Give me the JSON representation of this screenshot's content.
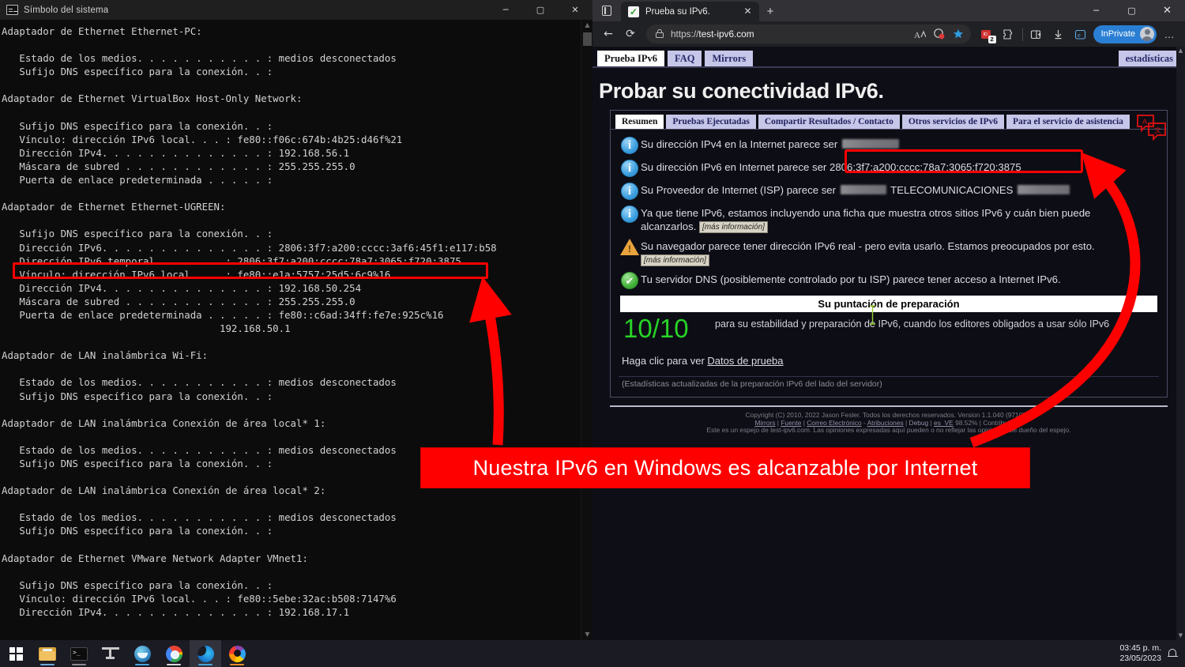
{
  "cmd": {
    "title": "Símbolo del sistema",
    "controls": {
      "minimize": "─",
      "maximize": "▢",
      "close": "✕"
    },
    "output": "Adaptador de Ethernet Ethernet-PC:\n\n   Estado de los medios. . . . . . . . . . . : medios desconectados\n   Sufijo DNS específico para la conexión. . :\n\nAdaptador de Ethernet VirtualBox Host-Only Network:\n\n   Sufijo DNS específico para la conexión. . :\n   Vínculo: dirección IPv6 local. . . : fe80::f06c:674b:4b25:d46f%21\n   Dirección IPv4. . . . . . . . . . . . . . : 192.168.56.1\n   Máscara de subred . . . . . . . . . . . . : 255.255.255.0\n   Puerta de enlace predeterminada . . . . . :\n\nAdaptador de Ethernet Ethernet-UGREEN:\n\n   Sufijo DNS específico para la conexión. . :\n   Dirección IPv6. . . . . . . . . . . . . . : 2806:3f7:a200:cccc:3af6:45f1:e117:b58\n   Dirección IPv6 temporal. . . . . . : 2806:3f7:a200:cccc:78a7:3065:f720:3875\n   Vínculo: dirección IPv6 local. . . : fe80::e1a:5757:25d5:6c9%16\n   Dirección IPv4. . . . . . . . . . . . . . : 192.168.50.254\n   Máscara de subred . . . . . . . . . . . . : 255.255.255.0\n   Puerta de enlace predeterminada . . . . . : fe80::c6ad:34ff:fe7e:925c%16\n                                     192.168.50.1\n\nAdaptador de LAN inalámbrica Wi-Fi:\n\n   Estado de los medios. . . . . . . . . . . : medios desconectados\n   Sufijo DNS específico para la conexión. . :\n\nAdaptador de LAN inalámbrica Conexión de área local* 1:\n\n   Estado de los medios. . . . . . . . . . . : medios desconectados\n   Sufijo DNS específico para la conexión. . :\n\nAdaptador de LAN inalámbrica Conexión de área local* 2:\n\n   Estado de los medios. . . . . . . . . . . : medios desconectados\n   Sufijo DNS específico para la conexión. . :\n\nAdaptador de Ethernet VMware Network Adapter VMnet1:\n\n   Sufijo DNS específico para la conexión. . :\n   Vínculo: dirección IPv6 local. . . : fe80::5ebe:32ac:b508:7147%6\n   Dirección IPv4. . . . . . . . . . . . . . : 192.168.17.1"
  },
  "browser": {
    "tab": {
      "title": "Prueba su IPv6.",
      "close_label": "✕"
    },
    "new_tab_label": "+",
    "window_controls": {
      "minimize": "─",
      "maximize": "▢",
      "close": "✕"
    },
    "nav": {
      "back": "←",
      "reload": "⟳"
    },
    "address": {
      "protocol": "https://",
      "host": "test-ipv6.com"
    },
    "inprivate_label": "InPrivate",
    "collections_badge": "2",
    "more_label": "…"
  },
  "site": {
    "tabs": [
      {
        "label": "Prueba IPv6",
        "active": true
      },
      {
        "label": "FAQ",
        "active": false
      },
      {
        "label": "Mirrors",
        "active": false
      }
    ],
    "stats_link": "estadísticas",
    "heading": "Probar su conectividad IPv6.",
    "panel_tabs": [
      {
        "label": "Resumen",
        "active": true
      },
      {
        "label": "Pruebas Ejecutadas",
        "active": false
      },
      {
        "label": "Compartir Resultados / Contacto",
        "active": false
      },
      {
        "label": "Otros servicios de IPv6",
        "active": false
      },
      {
        "label": "Para el servicio de asistencia",
        "active": false
      }
    ],
    "rows": [
      {
        "icon": "info-icon",
        "text": "Su dirección IPv4 en la Internet parece ser",
        "redacted": true,
        "value": ""
      },
      {
        "icon": "info-icon",
        "text": "Su dirección IPv6 en Internet parece ser",
        "value": "2806:3f7:a200:cccc:78a7:3065:f720:3875",
        "highlighted": true
      },
      {
        "icon": "info-icon",
        "text": "Su Proveedor de Internet (ISP) parece ser",
        "isp_middle": "TELECOMUNICACIONES",
        "redacted": true
      },
      {
        "icon": "info-icon",
        "text": "Ya que tiene IPv6, estamos incluyendo una ficha que muestra otros sitios IPv6 y cuán bien puede alcanzarlos.",
        "more_info": "[más información]"
      },
      {
        "icon": "warning-icon",
        "text": "Su navegador parece tener dirección IPv6 real - pero evita usarlo. Estamos preocupados por esto.",
        "more_info": "[más información]"
      },
      {
        "icon": "success-icon",
        "text": "Tu servidor DNS (posiblemente controlado por tu ISP) parece tener acceso a Internet IPv6."
      }
    ],
    "score_banner": "Su puntación de preparación",
    "score_value": "10/10",
    "score_desc": "para su estabilidad y preparación de IPv6, cuando los editores obligados a usar sólo IPv6",
    "testdata_prefix": "Haga clic para ver ",
    "testdata_link": "Datos de prueba",
    "stats_note": "(Estadísticas actualizadas de la preparación IPv6 del lado del servidor)",
    "footer": {
      "copyright": "Copyright (C) 2010, 2022 Jason Fesler. Todos los derechos reservados. Version 1.1.040 (971021)",
      "links": [
        "Mirrors",
        "Fuente",
        "Correo Electrónico",
        "Atribuciones",
        "Debug",
        "es_VE"
      ],
      "percent": "98.52%",
      "contribute": "Contribuir en:",
      "mirror_note": "Este es un espejo de test-ipv6.com. Las opiniones expresadas aquí pueden o no reflejar las opiniones del dueño del espejo."
    }
  },
  "annotation": {
    "callout_text": "Nuestra IPv6 en Windows es alcanzable por Internet",
    "accent_color": "#ff0000"
  },
  "taskbar": {
    "items": [
      {
        "name": "start-button",
        "label": "Inicio"
      },
      {
        "name": "file-explorer",
        "label": "Explorador de archivos"
      },
      {
        "name": "command-prompt",
        "label": "Símbolo del sistema"
      },
      {
        "name": "tool-app",
        "label": "Herramienta"
      },
      {
        "name": "blue-app",
        "label": "Aplicación"
      },
      {
        "name": "google-chrome",
        "label": "Google Chrome"
      },
      {
        "name": "microsoft-edge",
        "label": "Microsoft Edge"
      },
      {
        "name": "mozilla-firefox",
        "label": "Mozilla Firefox"
      }
    ],
    "clock": {
      "time": "03:45 p. m.",
      "date": "23/05/2023"
    }
  }
}
